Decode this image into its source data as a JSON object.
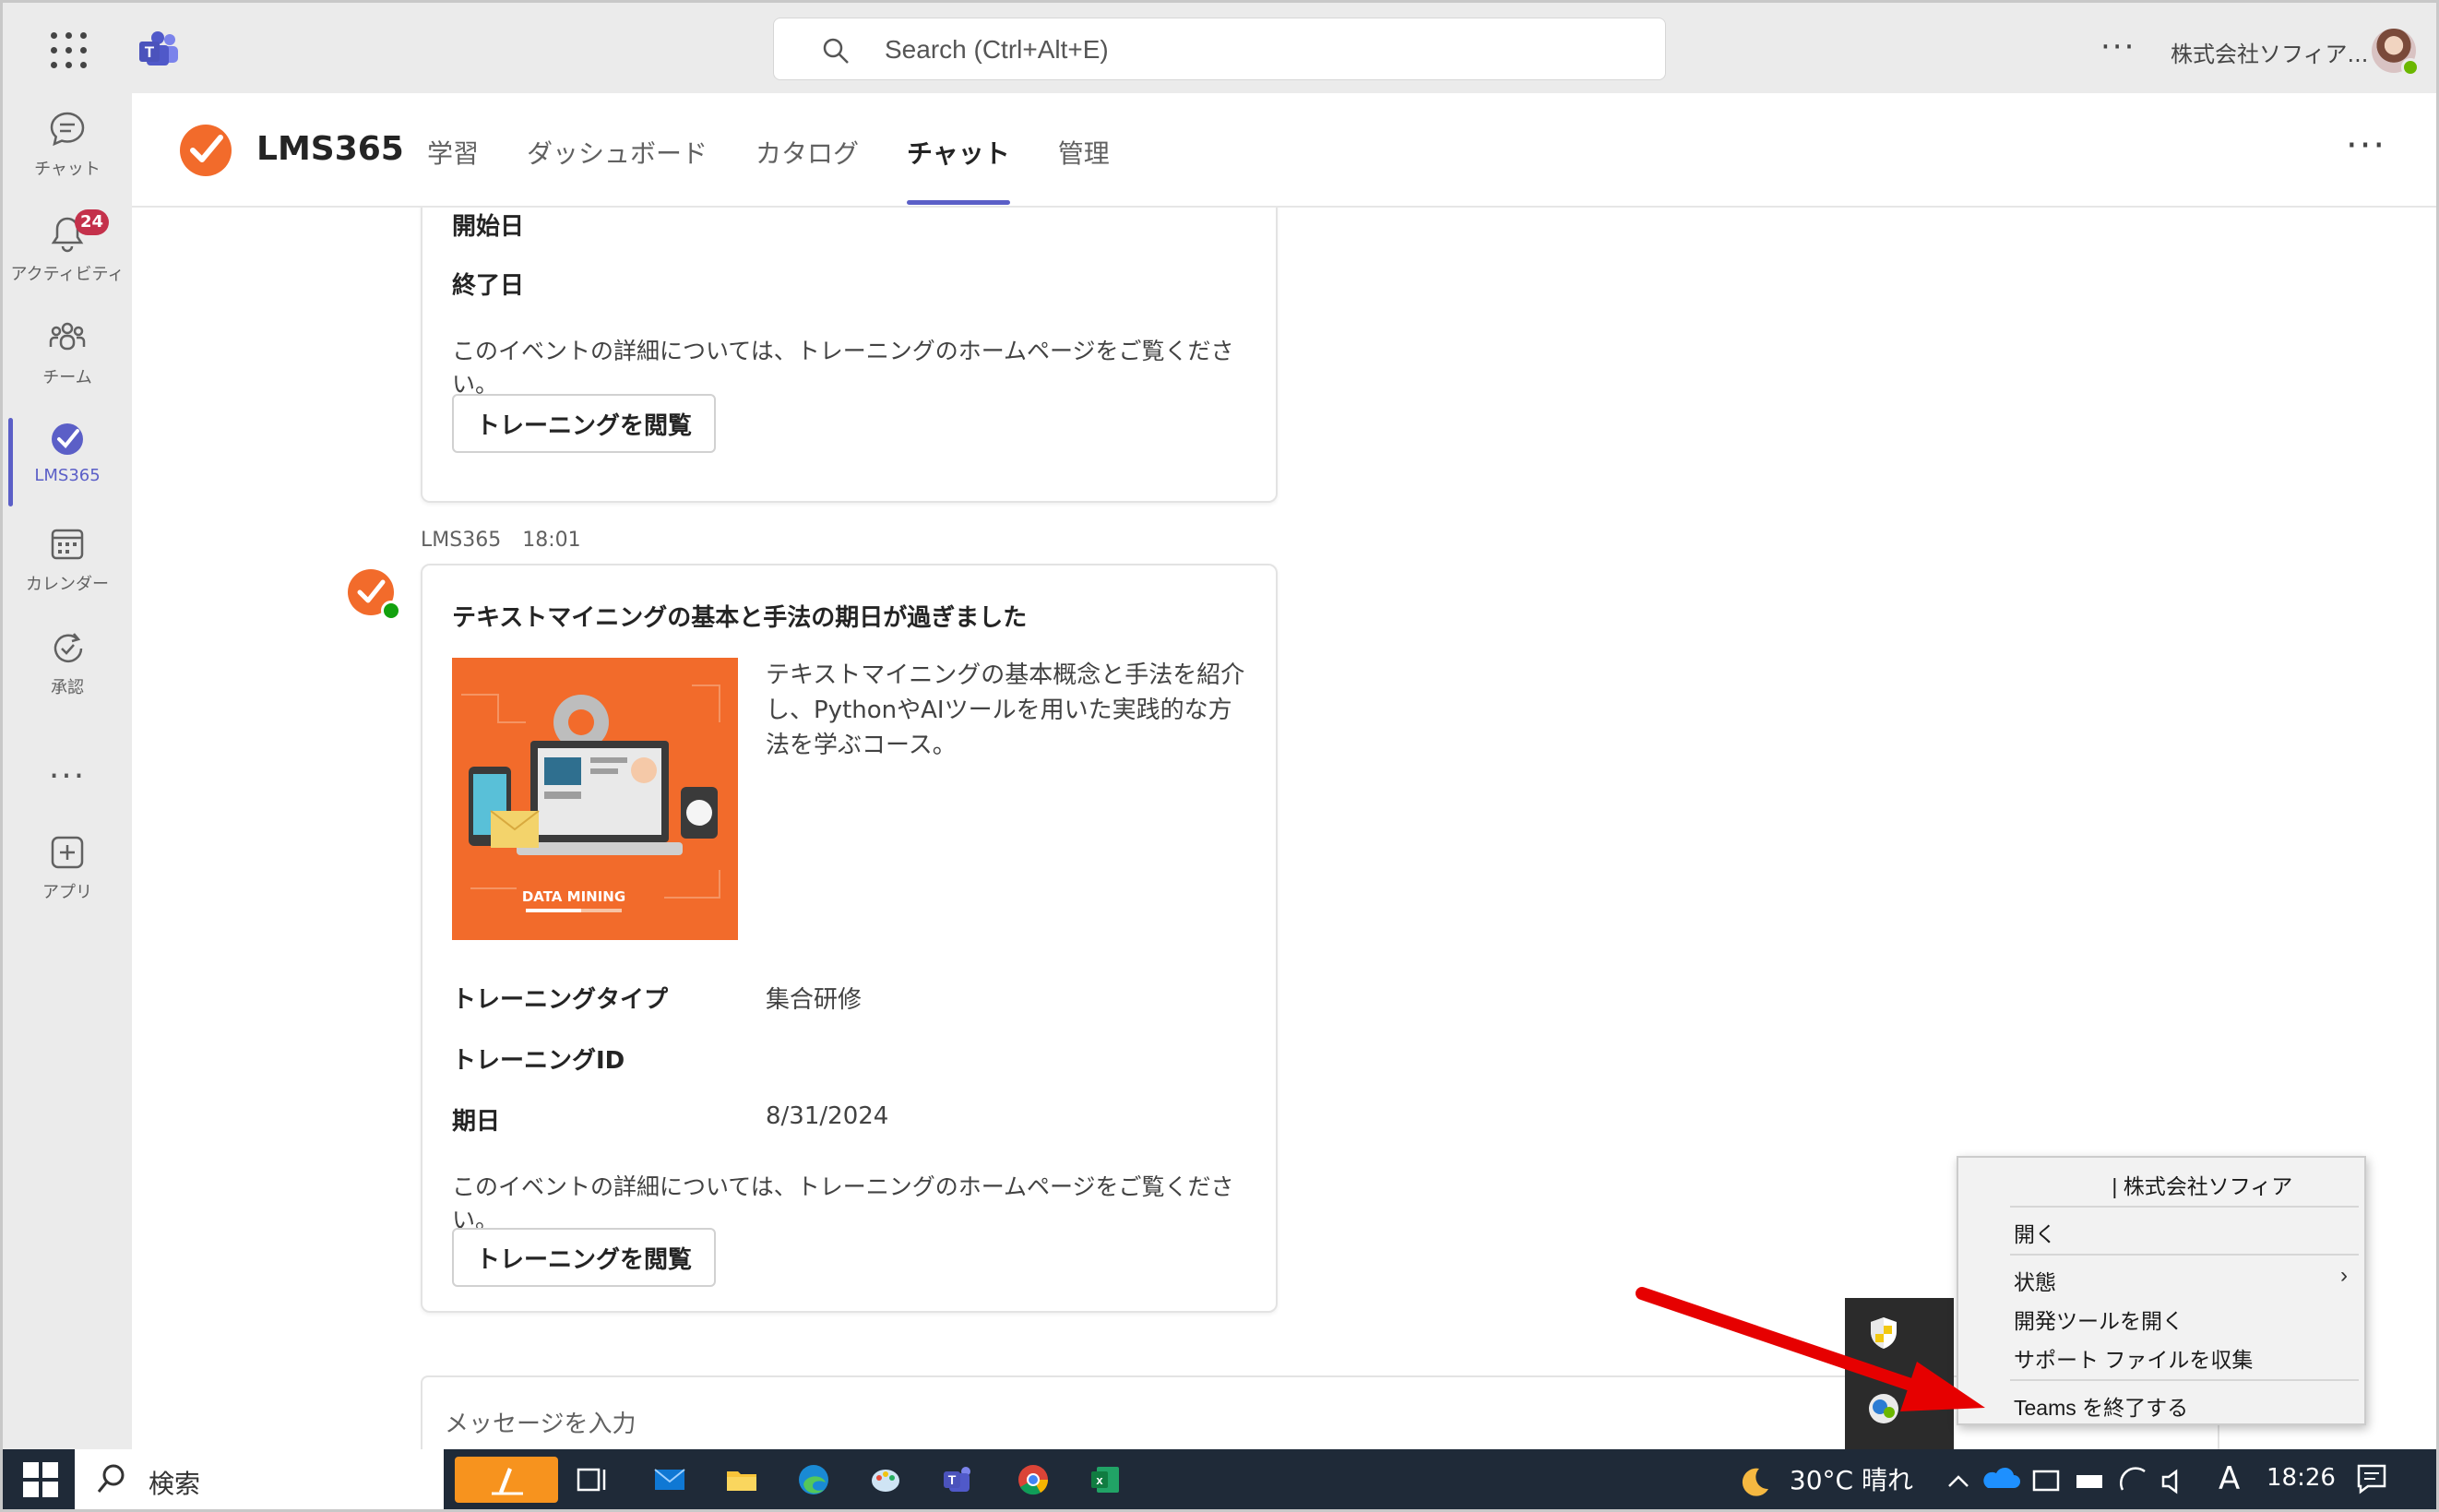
{
  "topbar": {
    "search_placeholder": "Search (Ctrl+Alt+E)",
    "more_label": "···",
    "org_name": "株式会社ソフィア..."
  },
  "rail": {
    "items": [
      {
        "label": "チャット",
        "icon": "chat-icon"
      },
      {
        "label": "アクティビティ",
        "icon": "bell-icon",
        "badge": "24"
      },
      {
        "label": "チーム",
        "icon": "teams-group-icon"
      },
      {
        "label": "LMS365",
        "icon": "lms365-icon",
        "active": true
      },
      {
        "label": "カレンダー",
        "icon": "calendar-icon"
      },
      {
        "label": "承認",
        "icon": "approvals-icon"
      },
      {
        "label": "アプリ",
        "icon": "add-app-icon"
      }
    ],
    "more_label": "···"
  },
  "app": {
    "name": "LMS365",
    "tabs": [
      {
        "label": "学習"
      },
      {
        "label": "ダッシュボード"
      },
      {
        "label": "カタログ"
      },
      {
        "label": "チャット",
        "active": true
      },
      {
        "label": "管理"
      }
    ],
    "more_label": "···"
  },
  "card1": {
    "start_label": "開始日",
    "end_label": "終了日",
    "note": "このイベントの詳細については、トレーニングのホームページをご覧ください。",
    "button": "トレーニングを閲覧"
  },
  "message": {
    "sender": "LMS365",
    "time": "18:01"
  },
  "card2": {
    "title": "テキストマイニングの基本と手法の期日が過ぎました",
    "image_caption": "DATA MINING",
    "description": "テキストマイニングの基本概念と手法を紹介し、PythonやAIツールを用いた実践的な方法を学ぶコース。",
    "fields": [
      {
        "label": "トレーニングタイプ",
        "value": "集合研修"
      },
      {
        "label": "トレーニングID",
        "value": ""
      },
      {
        "label": "期日",
        "value": "8/31/2024"
      }
    ],
    "note": "このイベントの詳細については、トレーニングのホームページをご覧ください。",
    "button": "トレーニングを閲覧"
  },
  "composer": {
    "placeholder": "メッセージを入力"
  },
  "context_menu": {
    "header": "| 株式会社ソフィア",
    "items": [
      "開く",
      "状態",
      "開発ツールを開く",
      "サポート ファイルを収集",
      "Teams を終了する"
    ]
  },
  "taskbar": {
    "search_label": "検索",
    "weather": "30°C 晴れ",
    "ime": "A",
    "time": "18:26"
  },
  "colors": {
    "accent": "#5b5fc7",
    "lms_orange": "#f26b2b",
    "badge_red": "#c4314b",
    "arrow_red": "#e60000",
    "taskbar": "#1f2a38"
  }
}
